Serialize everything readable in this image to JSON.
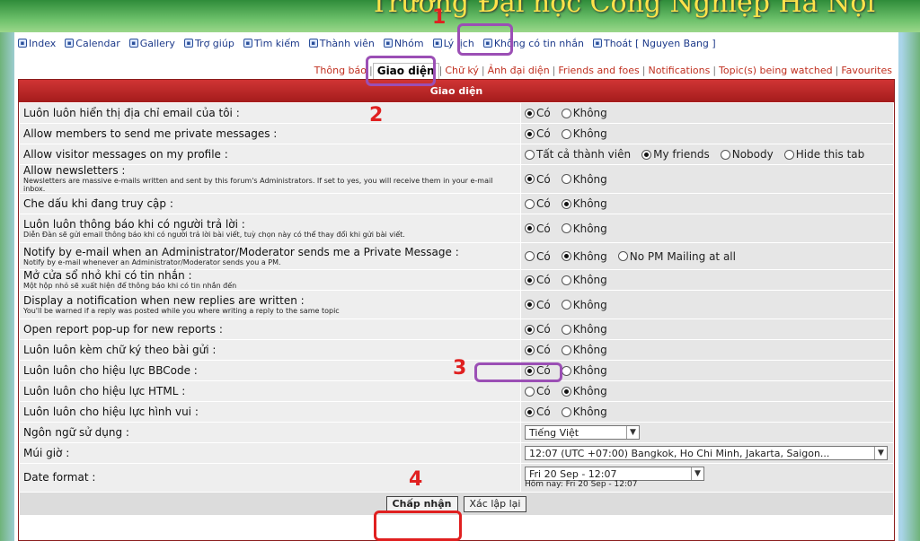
{
  "banner": {
    "title": "Trường Đại học Công Nghiệp Hà Nội"
  },
  "nav": [
    {
      "label": "Index",
      "icon": "index-icon"
    },
    {
      "label": "Calendar",
      "icon": "calendar-icon"
    },
    {
      "label": "Gallery",
      "icon": "gallery-icon"
    },
    {
      "label": "Trợ giúp",
      "icon": "help-icon"
    },
    {
      "label": "Tìm kiếm",
      "icon": "search-icon"
    },
    {
      "label": "Thành viên",
      "icon": "members-icon"
    },
    {
      "label": "Nhóm",
      "icon": "groups-icon"
    },
    {
      "label": "Lý lịch",
      "icon": "profile-icon"
    },
    {
      "label": "Không có tin nhắn",
      "icon": "messages-icon"
    },
    {
      "label": "Thoát [ Nguyen Bang ]",
      "icon": "logout-icon"
    }
  ],
  "tabs": [
    "Thông báo",
    "Giao diện",
    "Chữ ký",
    "Ảnh đại diện",
    "Friends and foes",
    "Notifications",
    "Topic(s) being watched",
    "Favourites"
  ],
  "active_tab": "Giao diện",
  "form": {
    "header": "Giao diện",
    "rows": [
      {
        "label": "Luôn luôn hiển thị địa chỉ email của tôi :",
        "options": [
          "Có",
          "Không"
        ],
        "selected": 0
      },
      {
        "label": "Allow members to send me private messages :",
        "options": [
          "Có",
          "Không"
        ],
        "selected": 0
      },
      {
        "label": "Allow visitor messages on my profile :",
        "options": [
          "Tất cả thành viên",
          "My friends",
          "Nobody",
          "Hide this tab"
        ],
        "selected": 1
      },
      {
        "label": "Allow newsletters :",
        "explain": "Newsletters are massive e-mails written and sent by this forum's Administrators. If set to yes, you will receive them in your e-mail inbox.",
        "options": [
          "Có",
          "Không"
        ],
        "selected": 0
      },
      {
        "label": "Che dấu khi đang truy cập :",
        "options": [
          "Có",
          "Không"
        ],
        "selected": 1
      },
      {
        "label": "Luôn luôn thông báo khi có người trả lời :",
        "explain": "Diễn Đàn sẽ gửi email thông báo khi có người trả lời bài viết, tuỳ chọn này có thể thay đổi khi gửi bài viết.",
        "options": [
          "Có",
          "Không"
        ],
        "selected": 0
      },
      {
        "label": "Notify by e-mail when an Administrator/Moderator sends me a Private Message :",
        "explain": "Notify by e-mail whenever an Administrator/Moderator sends you a PM.",
        "options": [
          "Có",
          "Không",
          "No PM Mailing at all"
        ],
        "selected": 1
      },
      {
        "label": "Mở cửa sổ nhỏ khi có tin nhắn :",
        "explain": "Một hộp nhỏ sẽ xuất hiện để thông báo khi có tin nhắn đến",
        "options": [
          "Có",
          "Không"
        ],
        "selected": 0
      },
      {
        "label": "Display a notification when new replies are written :",
        "explain": "You'll be warned if a reply was posted while you where writing a reply to the same topic",
        "options": [
          "Có",
          "Không"
        ],
        "selected": 0
      },
      {
        "label": "Open report pop-up for new reports :",
        "options": [
          "Có",
          "Không"
        ],
        "selected": 0
      },
      {
        "label": "Luôn luôn kèm chữ ký theo bài gửi :",
        "options": [
          "Có",
          "Không"
        ],
        "selected": 0
      },
      {
        "label": "Luôn luôn cho hiệu lực BBCode :",
        "options": [
          "Có",
          "Không"
        ],
        "selected": 0
      },
      {
        "label": "Luôn luôn cho hiệu lực HTML :",
        "options": [
          "Có",
          "Không"
        ],
        "selected": 1
      },
      {
        "label": "Luôn luôn cho hiệu lực hình vui :",
        "options": [
          "Có",
          "Không"
        ],
        "selected": 0
      }
    ],
    "language": {
      "label": "Ngôn ngữ sử dụng :",
      "value": "Tiếng Việt"
    },
    "timezone": {
      "label": "Múi giờ :",
      "value": "12:07 (UTC +07:00) Bangkok, Ho Chi Minh, Jakarta, Saigon..."
    },
    "dateformat": {
      "label": "Date format :",
      "value": "Fri 20 Sep - 12:07",
      "today": "Hôm nay: Fri 20 Sep - 12:07"
    },
    "submit_label": "Chấp nhận",
    "reset_label": "Xác lập lại"
  },
  "annotations": [
    "1",
    "2",
    "3",
    "4"
  ],
  "colors": {
    "header": "#b32424",
    "annotation": "#e02020",
    "highlight_box": "#9b4fb5",
    "link": "#c03020"
  }
}
